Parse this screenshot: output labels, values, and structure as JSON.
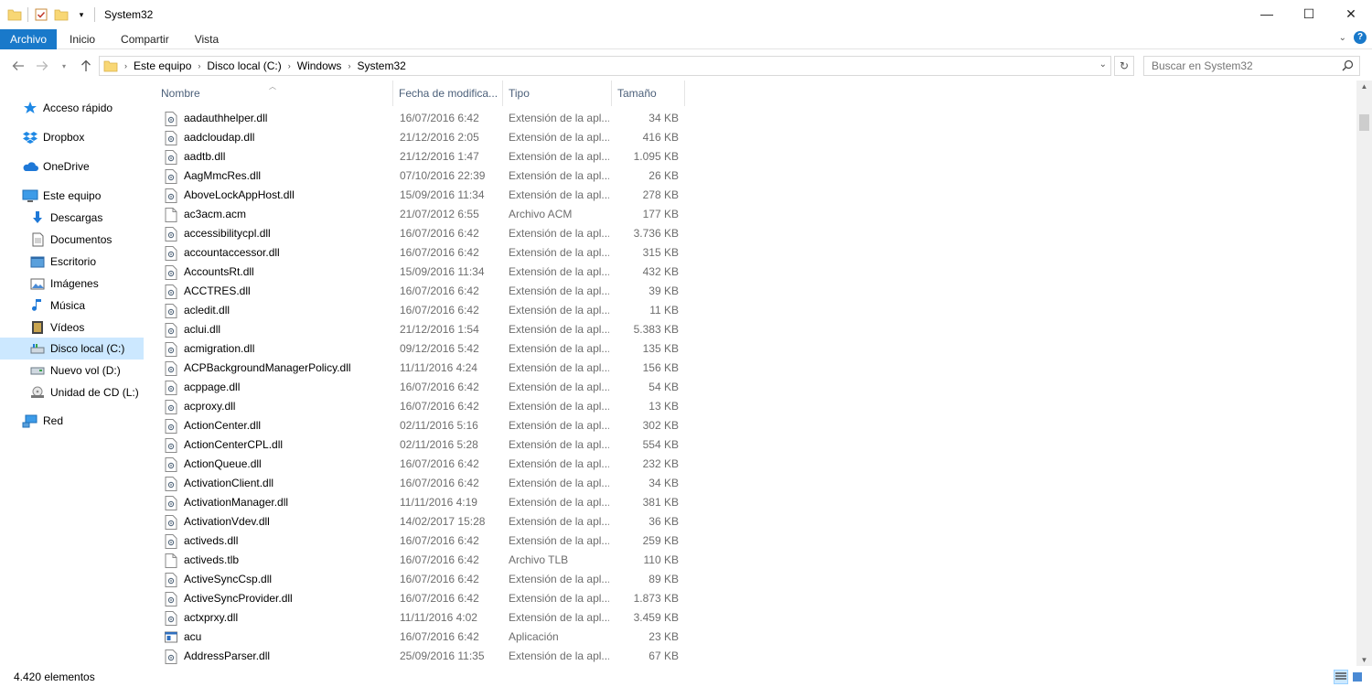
{
  "window": {
    "title": "System32",
    "minimize": "—",
    "maximize": "☐",
    "close": "✕"
  },
  "ribbon": {
    "tabs": [
      {
        "label": "Archivo"
      },
      {
        "label": "Inicio"
      },
      {
        "label": "Compartir"
      },
      {
        "label": "Vista"
      }
    ],
    "help": "?"
  },
  "address": {
    "crumbs": [
      "Este equipo",
      "Disco local (C:)",
      "Windows",
      "System32"
    ]
  },
  "search": {
    "placeholder": "Buscar en System32"
  },
  "sidebar": {
    "items": [
      {
        "label": "Acceso rápido",
        "icon": "star-icon"
      },
      {
        "label": "Dropbox",
        "icon": "dropbox-icon"
      },
      {
        "label": "OneDrive",
        "icon": "cloud-icon"
      },
      {
        "label": "Este equipo",
        "icon": "computer-icon"
      },
      {
        "label": "Descargas",
        "icon": "download-icon"
      },
      {
        "label": "Documentos",
        "icon": "document-icon"
      },
      {
        "label": "Escritorio",
        "icon": "desktop-icon"
      },
      {
        "label": "Imágenes",
        "icon": "image-icon"
      },
      {
        "label": "Música",
        "icon": "music-icon"
      },
      {
        "label": "Vídeos",
        "icon": "video-icon"
      },
      {
        "label": "Disco local (C:)",
        "icon": "drive-icon",
        "selected": true
      },
      {
        "label": "Nuevo vol (D:)",
        "icon": "drive-icon"
      },
      {
        "label": "Unidad de CD (L:)",
        "icon": "cd-drive-icon"
      },
      {
        "label": "Red",
        "icon": "network-icon"
      }
    ]
  },
  "columns": {
    "name": "Nombre",
    "date": "Fecha de modifica...",
    "type": "Tipo",
    "size": "Tamaño"
  },
  "files": [
    {
      "name": "aadauthhelper.dll",
      "date": "16/07/2016 6:42",
      "type": "Extensión de la apl...",
      "size": "34 KB",
      "icon": "dll"
    },
    {
      "name": "aadcloudap.dll",
      "date": "21/12/2016 2:05",
      "type": "Extensión de la apl...",
      "size": "416 KB",
      "icon": "dll"
    },
    {
      "name": "aadtb.dll",
      "date": "21/12/2016 1:47",
      "type": "Extensión de la apl...",
      "size": "1.095 KB",
      "icon": "dll"
    },
    {
      "name": "AagMmcRes.dll",
      "date": "07/10/2016 22:39",
      "type": "Extensión de la apl...",
      "size": "26 KB",
      "icon": "dll"
    },
    {
      "name": "AboveLockAppHost.dll",
      "date": "15/09/2016 11:34",
      "type": "Extensión de la apl...",
      "size": "278 KB",
      "icon": "dll"
    },
    {
      "name": "ac3acm.acm",
      "date": "21/07/2012 6:55",
      "type": "Archivo ACM",
      "size": "177 KB",
      "icon": "file"
    },
    {
      "name": "accessibilitycpl.dll",
      "date": "16/07/2016 6:42",
      "type": "Extensión de la apl...",
      "size": "3.736 KB",
      "icon": "dll"
    },
    {
      "name": "accountaccessor.dll",
      "date": "16/07/2016 6:42",
      "type": "Extensión de la apl...",
      "size": "315 KB",
      "icon": "dll"
    },
    {
      "name": "AccountsRt.dll",
      "date": "15/09/2016 11:34",
      "type": "Extensión de la apl...",
      "size": "432 KB",
      "icon": "dll"
    },
    {
      "name": "ACCTRES.dll",
      "date": "16/07/2016 6:42",
      "type": "Extensión de la apl...",
      "size": "39 KB",
      "icon": "dll"
    },
    {
      "name": "acledit.dll",
      "date": "16/07/2016 6:42",
      "type": "Extensión de la apl...",
      "size": "11 KB",
      "icon": "dll"
    },
    {
      "name": "aclui.dll",
      "date": "21/12/2016 1:54",
      "type": "Extensión de la apl...",
      "size": "5.383 KB",
      "icon": "dll"
    },
    {
      "name": "acmigration.dll",
      "date": "09/12/2016 5:42",
      "type": "Extensión de la apl...",
      "size": "135 KB",
      "icon": "dll"
    },
    {
      "name": "ACPBackgroundManagerPolicy.dll",
      "date": "11/11/2016 4:24",
      "type": "Extensión de la apl...",
      "size": "156 KB",
      "icon": "dll"
    },
    {
      "name": "acppage.dll",
      "date": "16/07/2016 6:42",
      "type": "Extensión de la apl...",
      "size": "54 KB",
      "icon": "dll"
    },
    {
      "name": "acproxy.dll",
      "date": "16/07/2016 6:42",
      "type": "Extensión de la apl...",
      "size": "13 KB",
      "icon": "dll"
    },
    {
      "name": "ActionCenter.dll",
      "date": "02/11/2016 5:16",
      "type": "Extensión de la apl...",
      "size": "302 KB",
      "icon": "dll"
    },
    {
      "name": "ActionCenterCPL.dll",
      "date": "02/11/2016 5:28",
      "type": "Extensión de la apl...",
      "size": "554 KB",
      "icon": "dll"
    },
    {
      "name": "ActionQueue.dll",
      "date": "16/07/2016 6:42",
      "type": "Extensión de la apl...",
      "size": "232 KB",
      "icon": "dll"
    },
    {
      "name": "ActivationClient.dll",
      "date": "16/07/2016 6:42",
      "type": "Extensión de la apl...",
      "size": "34 KB",
      "icon": "dll"
    },
    {
      "name": "ActivationManager.dll",
      "date": "11/11/2016 4:19",
      "type": "Extensión de la apl...",
      "size": "381 KB",
      "icon": "dll"
    },
    {
      "name": "ActivationVdev.dll",
      "date": "14/02/2017 15:28",
      "type": "Extensión de la apl...",
      "size": "36 KB",
      "icon": "dll"
    },
    {
      "name": "activeds.dll",
      "date": "16/07/2016 6:42",
      "type": "Extensión de la apl...",
      "size": "259 KB",
      "icon": "dll"
    },
    {
      "name": "activeds.tlb",
      "date": "16/07/2016 6:42",
      "type": "Archivo TLB",
      "size": "110 KB",
      "icon": "file"
    },
    {
      "name": "ActiveSyncCsp.dll",
      "date": "16/07/2016 6:42",
      "type": "Extensión de la apl...",
      "size": "89 KB",
      "icon": "dll"
    },
    {
      "name": "ActiveSyncProvider.dll",
      "date": "16/07/2016 6:42",
      "type": "Extensión de la apl...",
      "size": "1.873 KB",
      "icon": "dll"
    },
    {
      "name": "actxprxy.dll",
      "date": "11/11/2016 4:02",
      "type": "Extensión de la apl...",
      "size": "3.459 KB",
      "icon": "dll"
    },
    {
      "name": "acu",
      "date": "16/07/2016 6:42",
      "type": "Aplicación",
      "size": "23 KB",
      "icon": "exe"
    },
    {
      "name": "AddressParser.dll",
      "date": "25/09/2016 11:35",
      "type": "Extensión de la apl...",
      "size": "67 KB",
      "icon": "dll"
    }
  ],
  "status": {
    "count": "4.420 elementos"
  },
  "colors": {
    "accent": "#1979ca",
    "selection": "#cce8ff",
    "header_text": "#4c607a"
  }
}
